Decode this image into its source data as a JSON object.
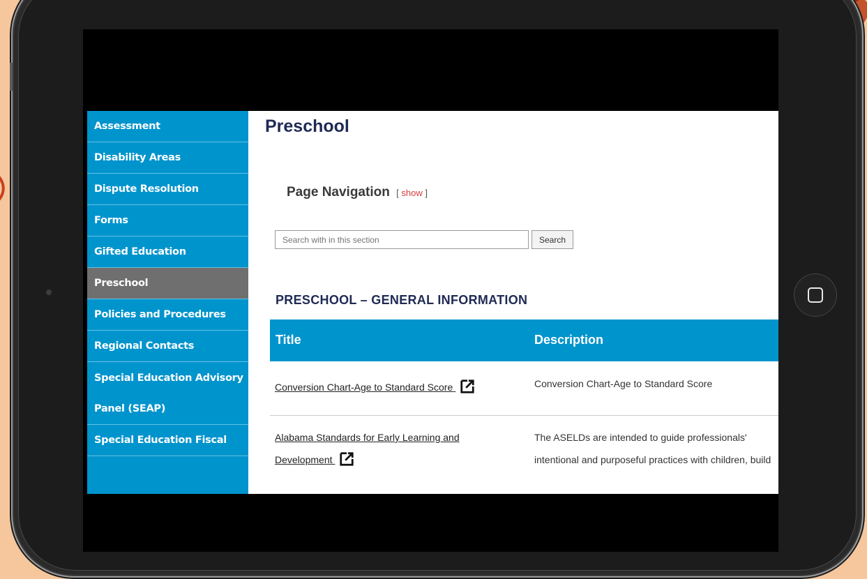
{
  "colors": {
    "background": "#f6c79c",
    "sidebar": "#0094cd",
    "sidebar_active": "#6f6f6f",
    "heading": "#1f2a54",
    "link_accent": "#d63c3c"
  },
  "sidebar": {
    "items": [
      {
        "label": "Assessment"
      },
      {
        "label": "Disability Areas"
      },
      {
        "label": "Dispute Resolution"
      },
      {
        "label": "Forms"
      },
      {
        "label": "Gifted Education"
      },
      {
        "label": "Preschool",
        "active": true
      },
      {
        "label": "Policies and Procedures"
      },
      {
        "label": "Regional Contacts"
      },
      {
        "label": "Special Education Advisory"
      },
      {
        "label": "Panel (SEAP)"
      },
      {
        "label": "Special Education Fiscal"
      }
    ]
  },
  "main": {
    "title": "Preschool",
    "page_nav": {
      "label": "Page Navigation",
      "bracket_open": "[",
      "toggle": "show",
      "bracket_close": "]"
    },
    "search": {
      "placeholder": "Search with in this section",
      "button": "Search"
    },
    "section_title": "PRESCHOOL – GENERAL INFORMATION",
    "table": {
      "headers": [
        "Title",
        "Description"
      ],
      "rows": [
        {
          "title": "Conversion Chart-Age to Standard Score",
          "description": "Conversion Chart-Age to Standard Score",
          "icon": "external-link-icon"
        },
        {
          "title_line1": "Alabama Standards for Early Learning and",
          "title_line2": "Development",
          "description_line1": "The ASELDs are intended to guide professionals'",
          "description_line2": "intentional and purposeful practices with children, build",
          "icon": "external-link-icon"
        }
      ]
    }
  },
  "device": {
    "home_button_icon": "home-square-icon"
  }
}
